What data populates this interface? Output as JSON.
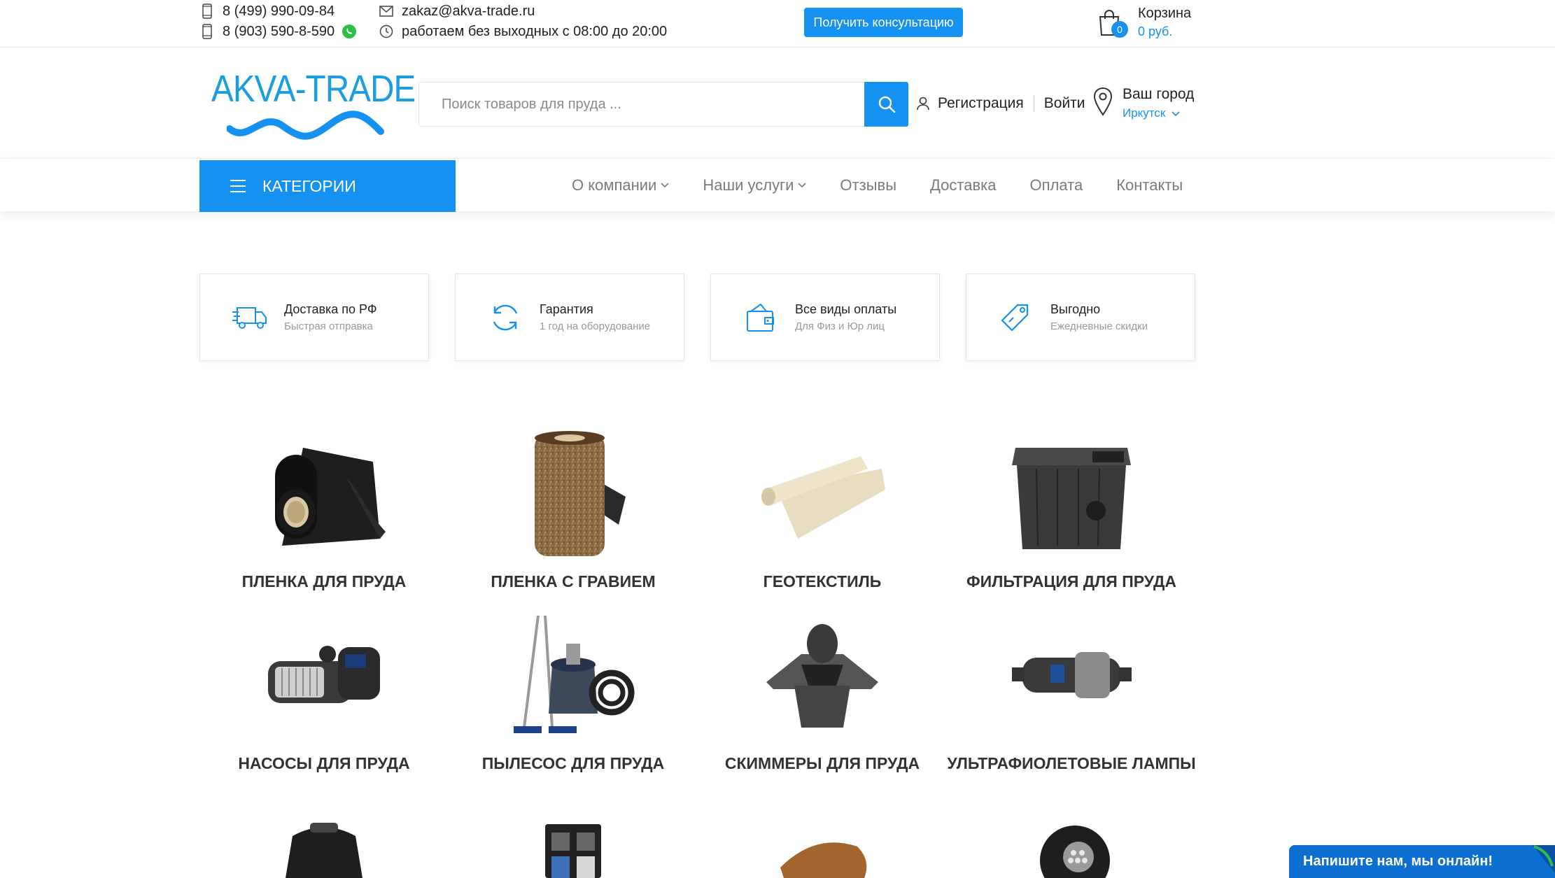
{
  "topbar": {
    "phone1": "8 (499) 990-09-84",
    "phone2": "8 (903) 590-8-590",
    "email": "zakaz@akva-trade.ru",
    "hours": "работаем без выходных с 08:00 до 20:00",
    "consult_button": "Получить консультацию",
    "cart": {
      "label": "Корзина",
      "sum": "0 руб.",
      "count": "0"
    }
  },
  "header": {
    "logo_text": "AKVA-TRADE",
    "search_placeholder": "Поиск товаров для пруда ...",
    "register": "Регистрация",
    "login": "Войти",
    "city_label": "Ваш город",
    "city_value": "Иркутск"
  },
  "nav": {
    "categories_button": "КАТЕГОРИИ",
    "items": [
      {
        "label": "О компании"
      },
      {
        "label": "Наши услуги"
      },
      {
        "label": "Отзывы"
      },
      {
        "label": "Доставка"
      },
      {
        "label": "Оплата"
      },
      {
        "label": "Контакты"
      }
    ]
  },
  "features": [
    {
      "title": "Доставка по РФ",
      "subtitle": "Быстрая отправка",
      "icon": "truck-icon"
    },
    {
      "title": "Гарантия",
      "subtitle": "1 год на оборудование",
      "icon": "refresh-icon"
    },
    {
      "title": "Все виды оплаты",
      "subtitle": "Для Физ и Юр лиц",
      "icon": "wallet-icon"
    },
    {
      "title": "Выгодно",
      "subtitle": "Ежедневные скидки",
      "icon": "tag-icon"
    }
  ],
  "categories": [
    {
      "name": "ПЛЕНКА ДЛЯ ПРУДА"
    },
    {
      "name": "ПЛЕНКА С ГРАВИЕМ"
    },
    {
      "name": "ГЕОТЕКСТИЛЬ"
    },
    {
      "name": "ФИЛЬТРАЦИЯ ДЛЯ ПРУДА"
    },
    {
      "name": "НАСОСЫ ДЛЯ ПРУДА"
    },
    {
      "name": "ПЫЛЕСОС ДЛЯ ПРУДА"
    },
    {
      "name": "СКИММЕРЫ ДЛЯ ПРУДА"
    },
    {
      "name": "УЛЬТРАФИОЛЕТОВЫЕ ЛАМПЫ"
    }
  ],
  "chat": {
    "label": "Напишите нам, мы онлайн!"
  },
  "colors": {
    "accent": "#1591f1",
    "text": "#222222",
    "muted": "#7a7a7a"
  }
}
